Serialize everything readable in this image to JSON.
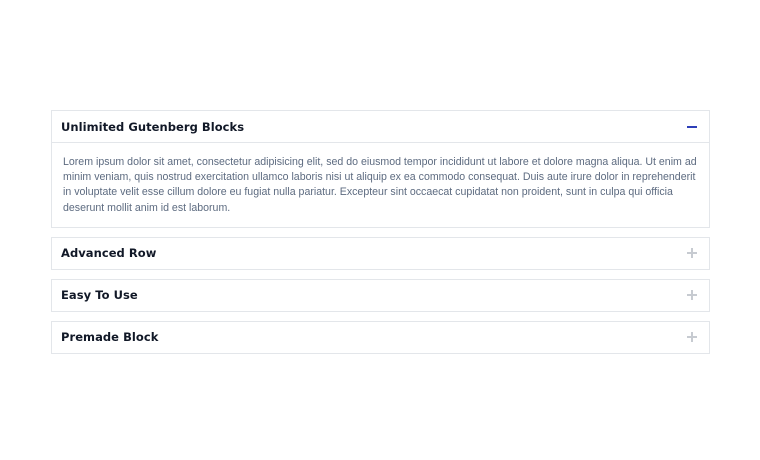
{
  "accordion": {
    "items": [
      {
        "title": "Unlimited Gutenberg Blocks",
        "expanded": true,
        "icon": "minus-icon",
        "content": "Lorem ipsum dolor sit amet, consectetur adipisicing elit, sed do eiusmod tempor incididunt ut labore et dolore magna aliqua. Ut enim ad minim veniam, quis nostrud exercitation ullamco laboris nisi ut aliquip ex ea commodo consequat. Duis aute irure dolor in reprehenderit in voluptate velit esse cillum dolore eu fugiat nulla pariatur. Excepteur sint occaecat cupidatat non proident, sunt in culpa qui officia deserunt mollit anim id est laborum."
      },
      {
        "title": "Advanced Row",
        "expanded": false,
        "icon": "plus-icon"
      },
      {
        "title": "Easy To Use",
        "expanded": false,
        "icon": "plus-icon"
      },
      {
        "title": "Premade Block",
        "expanded": false,
        "icon": "plus-icon"
      }
    ]
  },
  "colors": {
    "active_icon": "#2d3fb8",
    "inactive_icon": "#c7cbd1",
    "title": "#111827",
    "body_text": "#5d6b80",
    "border": "#e3e6ea"
  }
}
